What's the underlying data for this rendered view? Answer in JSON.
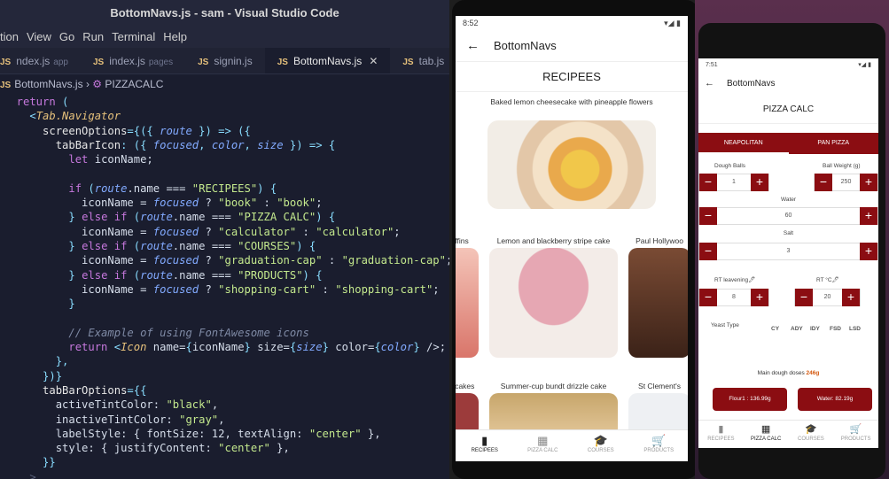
{
  "vscode": {
    "title": "BottomNavs.js - sam - Visual Studio Code",
    "menu": [
      "tion",
      "View",
      "Go",
      "Run",
      "Terminal",
      "Help"
    ],
    "tabs": [
      {
        "name": "ndex.js",
        "sub": "app"
      },
      {
        "name": "index.js",
        "sub": "pages"
      },
      {
        "name": "signin.js",
        "sub": ""
      },
      {
        "name": "BottomNavs.js",
        "sub": "",
        "active": true
      },
      {
        "name": "tab.js",
        "sub": ""
      }
    ],
    "breadcrumb_file": "BottomNavs.js",
    "breadcrumb_symbol": "PIZZACALC",
    "code": [
      [
        [
          "c-kw",
          "  return "
        ],
        [
          "c-pun",
          "("
        ]
      ],
      [
        [
          "c-pun",
          "    <"
        ],
        [
          "c-tag",
          "Tab.Navigator"
        ]
      ],
      [
        [
          "c-prop",
          "      screenOptions"
        ],
        [
          "c-pun",
          "={({ "
        ],
        [
          "c-var",
          "route"
        ],
        [
          "c-pun",
          " }) => ({"
        ]
      ],
      [
        [
          "c-prop",
          "        tabBarIcon"
        ],
        [
          "c-pun",
          ": ({ "
        ],
        [
          "c-var",
          "focused"
        ],
        [
          "c-pun",
          ", "
        ],
        [
          "c-var",
          "color"
        ],
        [
          "c-pun",
          ", "
        ],
        [
          "c-var",
          "size"
        ],
        [
          "c-pun",
          " }) => {"
        ]
      ],
      [
        [
          "c-kw",
          "          let "
        ],
        [
          "c-tx",
          "iconName;"
        ]
      ],
      [
        [
          "c-tx",
          ""
        ]
      ],
      [
        [
          "c-kw",
          "          if "
        ],
        [
          "c-pun",
          "("
        ],
        [
          "c-var",
          "route"
        ],
        [
          "c-tx",
          ".name === "
        ],
        [
          "c-str",
          "\"RECIPEES\""
        ],
        [
          "c-pun",
          ") {"
        ]
      ],
      [
        [
          "c-tx",
          "            iconName = "
        ],
        [
          "c-var",
          "focused"
        ],
        [
          "c-tx",
          " ? "
        ],
        [
          "c-str",
          "\"book\""
        ],
        [
          "c-tx",
          " : "
        ],
        [
          "c-str",
          "\"book\""
        ],
        [
          "c-tx",
          ";"
        ]
      ],
      [
        [
          "c-pun",
          "          } "
        ],
        [
          "c-kw",
          "else if "
        ],
        [
          "c-pun",
          "("
        ],
        [
          "c-var",
          "route"
        ],
        [
          "c-tx",
          ".name === "
        ],
        [
          "c-str",
          "\"PIZZA CALC\""
        ],
        [
          "c-pun",
          ") {"
        ]
      ],
      [
        [
          "c-tx",
          "            iconName = "
        ],
        [
          "c-var",
          "focused"
        ],
        [
          "c-tx",
          " ? "
        ],
        [
          "c-str",
          "\"calculator\""
        ],
        [
          "c-tx",
          " : "
        ],
        [
          "c-str",
          "\"calculator\""
        ],
        [
          "c-tx",
          ";"
        ]
      ],
      [
        [
          "c-pun",
          "          } "
        ],
        [
          "c-kw",
          "else if "
        ],
        [
          "c-pun",
          "("
        ],
        [
          "c-var",
          "route"
        ],
        [
          "c-tx",
          ".name === "
        ],
        [
          "c-str",
          "\"COURSES\""
        ],
        [
          "c-pun",
          ") {"
        ]
      ],
      [
        [
          "c-tx",
          "            iconName = "
        ],
        [
          "c-var",
          "focused"
        ],
        [
          "c-tx",
          " ? "
        ],
        [
          "c-str",
          "\"graduation-cap\""
        ],
        [
          "c-tx",
          " : "
        ],
        [
          "c-str",
          "\"graduation-cap\""
        ],
        [
          "c-tx",
          ";"
        ]
      ],
      [
        [
          "c-pun",
          "          } "
        ],
        [
          "c-kw",
          "else if "
        ],
        [
          "c-pun",
          "("
        ],
        [
          "c-var",
          "route"
        ],
        [
          "c-tx",
          ".name === "
        ],
        [
          "c-str",
          "\"PRODUCTS\""
        ],
        [
          "c-pun",
          ") {"
        ]
      ],
      [
        [
          "c-tx",
          "            iconName = "
        ],
        [
          "c-var",
          "focused"
        ],
        [
          "c-tx",
          " ? "
        ],
        [
          "c-str",
          "\"shopping-cart\""
        ],
        [
          "c-tx",
          " : "
        ],
        [
          "c-str",
          "\"shopping-cart\""
        ],
        [
          "c-tx",
          ";"
        ]
      ],
      [
        [
          "c-pun",
          "          }"
        ]
      ],
      [
        [
          "c-tx",
          ""
        ]
      ],
      [
        [
          "c-cm",
          "          // Example of using FontAwesome icons"
        ]
      ],
      [
        [
          "c-kw",
          "          return "
        ],
        [
          "c-pun",
          "<"
        ],
        [
          "c-tag",
          "Icon"
        ],
        [
          "c-tx",
          " name="
        ],
        [
          "c-pun",
          "{"
        ],
        [
          "c-tx",
          "iconName"
        ],
        [
          "c-pun",
          "}"
        ],
        [
          "c-tx",
          " size="
        ],
        [
          "c-pun",
          "{"
        ],
        [
          "c-var",
          "size"
        ],
        [
          "c-pun",
          "}"
        ],
        [
          "c-tx",
          " color="
        ],
        [
          "c-pun",
          "{"
        ],
        [
          "c-var",
          "color"
        ],
        [
          "c-pun",
          "}"
        ],
        [
          "c-tx",
          " />;"
        ]
      ],
      [
        [
          "c-pun",
          "        },"
        ]
      ],
      [
        [
          "c-pun",
          "      })}"
        ]
      ],
      [
        [
          "c-prop",
          "      tabBarOptions"
        ],
        [
          "c-pun",
          "={{"
        ]
      ],
      [
        [
          "c-tx",
          "        activeTintColor: "
        ],
        [
          "c-str",
          "\"black\""
        ],
        [
          "c-tx",
          ","
        ]
      ],
      [
        [
          "c-tx",
          "        inactiveTintColor: "
        ],
        [
          "c-str",
          "\"gray\""
        ],
        [
          "c-tx",
          ","
        ]
      ],
      [
        [
          "c-tx",
          "        labelStyle: { fontSize: 12, textAlign: "
        ],
        [
          "c-str",
          "\"center\""
        ],
        [
          "c-tx",
          " },"
        ]
      ],
      [
        [
          "c-tx",
          "        style: { justifyContent: "
        ],
        [
          "c-str",
          "\"center\""
        ],
        [
          "c-tx",
          " },"
        ]
      ],
      [
        [
          "c-pun",
          "      }}"
        ]
      ],
      [
        [
          "c-dim",
          "    >"
        ]
      ]
    ]
  },
  "phone1": {
    "status_time": "8:52",
    "status_icons": "▾◢ ▮",
    "app_title": "BottomNavs",
    "screen_title": "RECIPEES",
    "featured_caption": "Baked lemon cheesecake with pineapple flowers",
    "row1": [
      "ffins",
      "Lemon and blackberry stripe cake",
      "Paul Hollywoo"
    ],
    "row2": [
      "y cakes",
      "Summer-cup bundt drizzle cake",
      "St Clement's"
    ],
    "tabs": [
      {
        "label": "RECIPEES",
        "icon": "book-icon",
        "glyph": "▮"
      },
      {
        "label": "PIZZA CALC",
        "icon": "calculator-icon",
        "glyph": "▦"
      },
      {
        "label": "COURSES",
        "icon": "graduation-cap-icon",
        "glyph": "🎓"
      },
      {
        "label": "PRODUCTS",
        "icon": "shopping-cart-icon",
        "glyph": "🛒"
      }
    ]
  },
  "phone2": {
    "status_time": "7:51",
    "status_icons": "▾◢ ▮",
    "app_title": "BottomNavs",
    "screen_title": "PIZZA CALC",
    "tab_neapolitan": "NEAPOLITAN",
    "tab_pan": "PAN PIZZA",
    "dough_balls_label": "Dough Balls",
    "dough_balls_value": "1",
    "ball_weight_label": "Ball Weight (g)",
    "ball_weight_value": "250",
    "water_label": "Water",
    "water_value": "60",
    "salt_label": "Salt",
    "salt_value": "3",
    "rt_leavening_label": "RT leavening🖊",
    "rt_leavening_value": "8",
    "rt_c_label": "RT °C🖊",
    "rt_c_value": "20",
    "yeast_label": "Yeast Type",
    "yeast_types": [
      "CY",
      "ADY",
      "IDY",
      "FSD",
      "LSD"
    ],
    "main_dough_text": "Main dough doses",
    "main_dough_value": "246g",
    "flour_btn": "Flour1 : 136.99g",
    "water_btn": "Water: 82.19g",
    "tabs": [
      {
        "label": "RECIPEES",
        "icon": "book-icon",
        "glyph": "▮"
      },
      {
        "label": "PIZZA CALC",
        "icon": "calculator-icon",
        "glyph": "▦"
      },
      {
        "label": "COURSES",
        "icon": "graduation-cap-icon",
        "glyph": "🎓"
      },
      {
        "label": "PRODUCTS",
        "icon": "shopping-cart-icon",
        "glyph": "🛒"
      }
    ]
  },
  "colors": {
    "accent": "#8b0d12",
    "editor_bg": "#1a1d2e"
  }
}
